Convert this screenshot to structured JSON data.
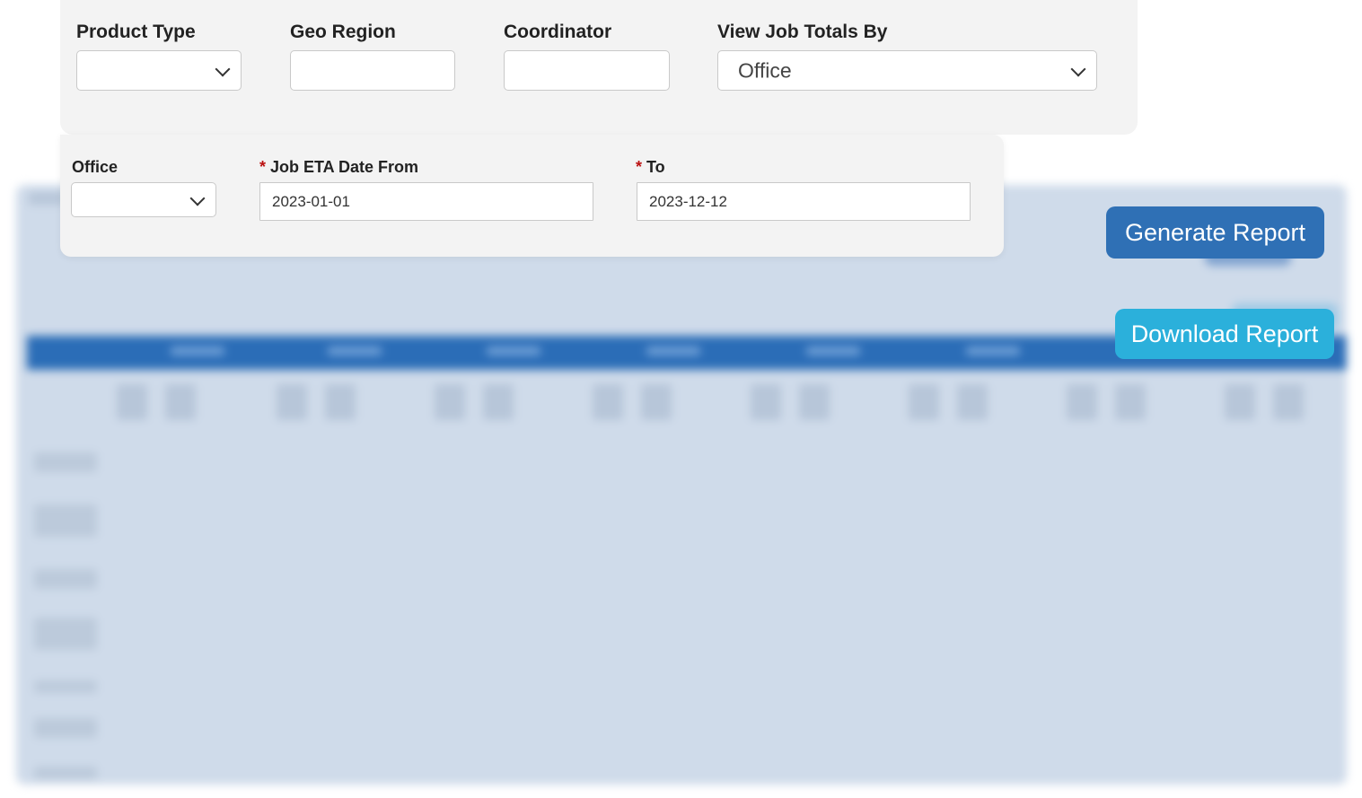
{
  "filters": {
    "product_type": {
      "label": "Product Type",
      "value": ""
    },
    "geo_region": {
      "label": "Geo Region",
      "value": ""
    },
    "coordinator": {
      "label": "Coordinator",
      "value": ""
    },
    "view_job_totals_by": {
      "label": "View Job Totals By",
      "value": "Office"
    },
    "office": {
      "label": "Office",
      "value": ""
    },
    "job_eta_date_from": {
      "label": "Job ETA Date From",
      "required_marker": "*",
      "value": "2023-01-01"
    },
    "job_eta_date_to": {
      "label": "To",
      "required_marker": "*",
      "value": "2023-12-12"
    }
  },
  "actions": {
    "generate_label": "Generate Report",
    "download_label": "Download Report"
  },
  "colors": {
    "generate_button": "#2f70b5",
    "download_button": "#2bb0db",
    "required_marker": "#b11111",
    "panel_background": "#f3f3f3"
  },
  "icons": {
    "select_chevron": "chevron-down-icon"
  }
}
